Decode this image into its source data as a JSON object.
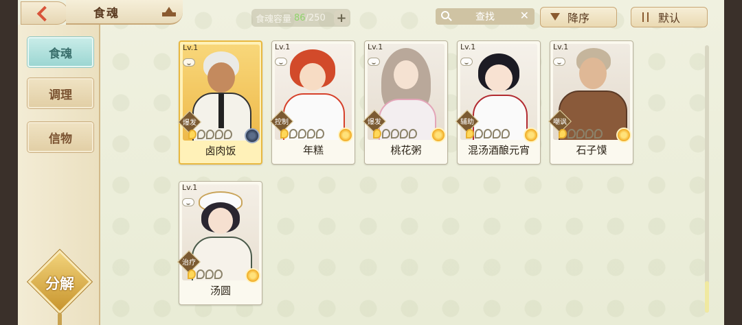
{
  "header": {
    "title": "食魂",
    "capacity": {
      "label": "食魂容量",
      "current": "86",
      "separator": "/",
      "max": "250"
    },
    "search_label": "查找",
    "sort_desc_label": "降序",
    "sort_default_label": "默认"
  },
  "sidebar": {
    "items": [
      {
        "label": "食魂",
        "active": true
      },
      {
        "label": "调理",
        "active": false
      },
      {
        "label": "信物",
        "active": false
      }
    ],
    "decompose_label": "分解"
  },
  "cards": [
    {
      "level": "Lv.1",
      "name": "卤肉饭",
      "role": "爆发",
      "stars_on": 1,
      "stars_total": 5,
      "element": "dark",
      "gold": true
    },
    {
      "level": "Lv.1",
      "name": "年糕",
      "role": "控制",
      "stars_on": 1,
      "stars_total": 5,
      "element": "gold",
      "gold": false
    },
    {
      "level": "Lv.1",
      "name": "桃花粥",
      "role": "爆发",
      "stars_on": 1,
      "stars_total": 5,
      "element": "gold",
      "gold": false
    },
    {
      "level": "Lv.1",
      "name": "混汤酒酿元宵",
      "role": "辅助",
      "stars_on": 1,
      "stars_total": 5,
      "element": "gold",
      "gold": false
    },
    {
      "level": "Lv.1",
      "name": "石子馍",
      "role": "嘲讽",
      "stars_on": 1,
      "stars_total": 5,
      "element": "gold",
      "gold": false
    },
    {
      "level": "Lv.1",
      "name": "汤圆",
      "role": "治疗",
      "stars_on": 1,
      "stars_total": 4,
      "element": "gold",
      "gold": false
    }
  ],
  "colors": {
    "background": "#eef0de",
    "accent_teal": "#9cd6d2",
    "gold_card": "#fff1b8",
    "capacity_current": "#8fd36b"
  }
}
